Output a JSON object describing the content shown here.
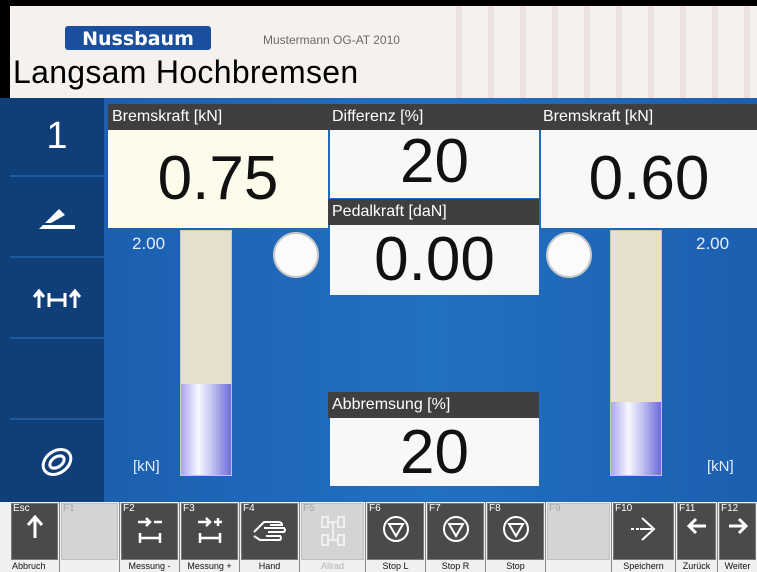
{
  "header": {
    "brand": "Nussbaum",
    "company": "Mustermann OG-AT 2010",
    "title": "Langsam Hochbremsen"
  },
  "sidebar": {
    "axle_number": "1",
    "items": [
      {
        "icon": "brake-pedal-icon"
      },
      {
        "icon": "axle-arrows-icon"
      },
      {
        "icon": "empty"
      },
      {
        "icon": "swirl-logo-icon"
      }
    ]
  },
  "left_panel": {
    "caption": "Bremskraft [kN]",
    "value": "0.75",
    "scale_max": "2.00",
    "unit": "[kN]",
    "bar_level": 0.375,
    "lamp": "off"
  },
  "center_panel": {
    "difference_caption": "Differenz [%]",
    "difference_value": "20",
    "pedal_caption": "Pedalkraft [daN]",
    "pedal_value": "0.00",
    "braking_caption": "Abbremsung [%]",
    "braking_value": "20"
  },
  "right_panel": {
    "caption": "Bremskraft [kN]",
    "value": "0.60",
    "scale_max": "2.00",
    "unit": "[kN]",
    "bar_level": 0.3,
    "lamp": "off"
  },
  "function_keys": [
    {
      "key": "Esc",
      "label": "Abbruch",
      "icon": "arrow-up-icon",
      "enabled": true
    },
    {
      "key": "F1",
      "label": "",
      "icon": "none",
      "enabled": false
    },
    {
      "key": "F2",
      "label": "Messung -",
      "icon": "measure-minus-icon",
      "enabled": true
    },
    {
      "key": "F3",
      "label": "Messung +",
      "icon": "measure-plus-icon",
      "enabled": true
    },
    {
      "key": "F4",
      "label": "Hand",
      "icon": "hand-icon",
      "enabled": true
    },
    {
      "key": "F5",
      "label": "Allrad",
      "icon": "all-wheel-icon",
      "enabled": false
    },
    {
      "key": "F6",
      "label": "Stop L",
      "icon": "stop-triangle-icon",
      "enabled": true
    },
    {
      "key": "F7",
      "label": "Stop R",
      "icon": "stop-triangle-icon",
      "enabled": true
    },
    {
      "key": "F8",
      "label": "Stop",
      "icon": "stop-triangle-icon",
      "enabled": true
    },
    {
      "key": "F9",
      "label": "",
      "icon": "none",
      "enabled": false
    },
    {
      "key": "F10",
      "label": "Speichern",
      "icon": "save-arrow-icon",
      "enabled": true
    },
    {
      "key": "F11",
      "label": "Zurück",
      "icon": "arrow-left-icon",
      "enabled": true
    },
    {
      "key": "F12",
      "label": "Weiter",
      "icon": "arrow-right-icon",
      "enabled": true
    }
  ],
  "colors": {
    "background_blue": "#1c5fb0",
    "sidebar_blue": "#0f3e78",
    "caption_dark": "#3f3f3f",
    "value_cream": "#fdfbea",
    "bar_fill": "#8f8de6"
  }
}
